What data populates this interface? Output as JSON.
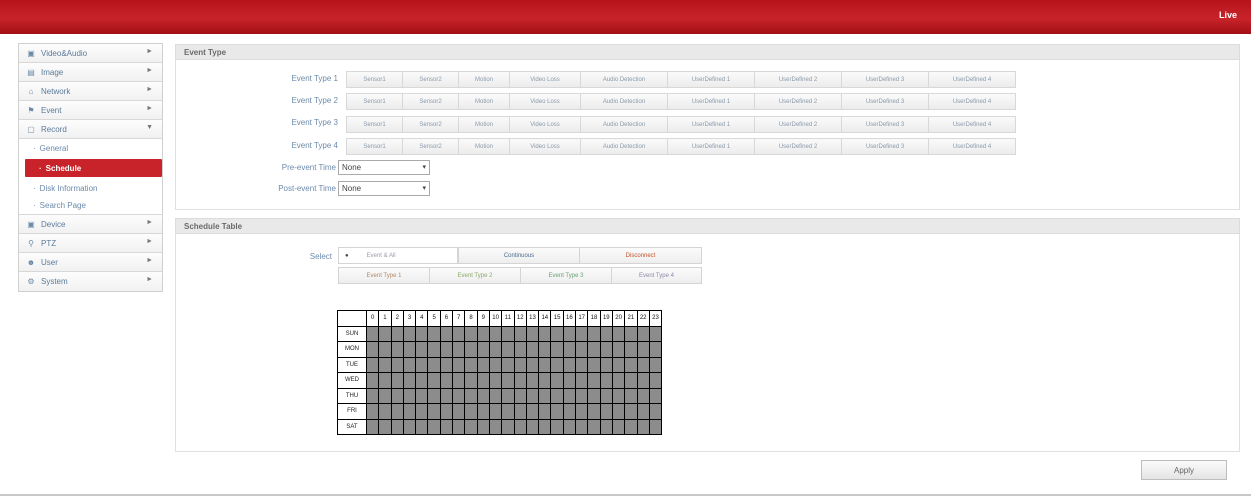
{
  "header": {
    "live_label": "Live"
  },
  "sidebar": {
    "items": [
      {
        "label": "Video&Audio",
        "icon": "video-icon"
      },
      {
        "label": "Image",
        "icon": "image-icon"
      },
      {
        "label": "Network",
        "icon": "network-icon"
      },
      {
        "label": "Event",
        "icon": "event-icon"
      },
      {
        "label": "Record",
        "icon": "record-icon",
        "expanded": true
      },
      {
        "label": "Device",
        "icon": "device-icon"
      },
      {
        "label": "PTZ",
        "icon": "ptz-icon"
      },
      {
        "label": "User",
        "icon": "user-icon"
      },
      {
        "label": "System",
        "icon": "system-icon"
      }
    ],
    "record_sub": [
      {
        "label": "General"
      },
      {
        "label": "Schedule",
        "active": true
      },
      {
        "label": "Disk Information"
      },
      {
        "label": "Search Page"
      }
    ]
  },
  "event_type": {
    "title": "Event Type",
    "rows": [
      {
        "label": "Event Type 1"
      },
      {
        "label": "Event Type 2"
      },
      {
        "label": "Event Type 3"
      },
      {
        "label": "Event Type 4"
      }
    ],
    "buttons": [
      "Sensor1",
      "Sensor2",
      "Motion",
      "Video Loss",
      "Audio Detection",
      "UserDefined 1",
      "UserDefined 2",
      "UserDefined 3",
      "UserDefined 4"
    ],
    "pre_event": {
      "label": "Pre-event Time",
      "value": "None"
    },
    "post_event": {
      "label": "Post-event Time",
      "value": "None"
    }
  },
  "schedule_table": {
    "title": "Schedule Table",
    "select_label": "Select",
    "options_row1": [
      "Event & All",
      "Continuous",
      "Disconnect"
    ],
    "options_row2": [
      "Event Type 1",
      "Event Type 2",
      "Event Type 3",
      "Event Type 4"
    ],
    "colors": {
      "continuous": "#4a6a8a",
      "disconnect": "#c0522a",
      "event1": "#b08a6a",
      "event2": "#8aaa6a",
      "event3": "#6aa07a",
      "event4": "#8a8aaa"
    },
    "hours": [
      "0",
      "1",
      "2",
      "3",
      "4",
      "5",
      "6",
      "7",
      "8",
      "9",
      "10",
      "11",
      "12",
      "13",
      "14",
      "15",
      "16",
      "17",
      "18",
      "19",
      "20",
      "21",
      "22",
      "23"
    ],
    "days": [
      "SUN",
      "MON",
      "TUE",
      "WED",
      "THU",
      "FRI",
      "SAT"
    ],
    "cell_color": "#8c8c8c"
  },
  "apply_label": "Apply",
  "theme": {
    "brand_red": "#c8232a"
  }
}
